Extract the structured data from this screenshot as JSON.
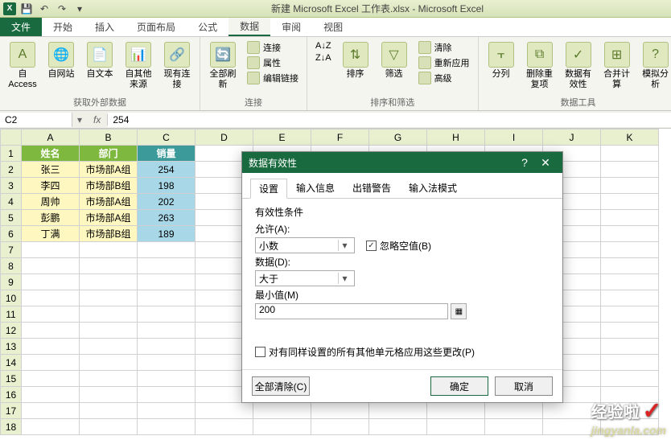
{
  "title": "新建 Microsoft Excel 工作表.xlsx - Microsoft Excel",
  "tabs": {
    "file": "文件",
    "items": [
      "开始",
      "插入",
      "页面布局",
      "公式",
      "数据",
      "审阅",
      "视图"
    ],
    "active_index": 4
  },
  "ribbon": {
    "g1": {
      "label": "获取外部数据",
      "btns": [
        "自 Access",
        "自网站",
        "自文本",
        "自其他来源",
        "现有连接"
      ]
    },
    "g2": {
      "label": "连接",
      "big": "全部刷新",
      "small": [
        "连接",
        "属性",
        "编辑链接"
      ]
    },
    "g3": {
      "label": "排序和筛选",
      "az": "A↓Z",
      "za": "Z↓A",
      "big": [
        "排序",
        "筛选"
      ],
      "small": [
        "清除",
        "重新应用",
        "高级"
      ]
    },
    "g4": {
      "label": "数据工具",
      "big": [
        "分列",
        "删除重复项",
        "数据有效性",
        "合并计算",
        "模拟分析"
      ]
    }
  },
  "formula_bar": {
    "name_box": "C2",
    "fx": "fx",
    "value": "254"
  },
  "columns": [
    "A",
    "B",
    "C",
    "D",
    "E",
    "F",
    "G",
    "H",
    "I",
    "J",
    "K"
  ],
  "rows_shown": 18,
  "headers": {
    "name": "姓名",
    "dept": "部门",
    "sales": "销量"
  },
  "data_rows": [
    {
      "name": "张三",
      "dept": "市场部A组",
      "sales": "254"
    },
    {
      "name": "李四",
      "dept": "市场部B组",
      "sales": "198"
    },
    {
      "name": "周帅",
      "dept": "市场部A组",
      "sales": "202"
    },
    {
      "name": "彭鹏",
      "dept": "市场部A组",
      "sales": "263"
    },
    {
      "name": "丁满",
      "dept": "市场部B组",
      "sales": "189"
    }
  ],
  "dialog": {
    "title": "数据有效性",
    "tabs": [
      "设置",
      "输入信息",
      "出错警告",
      "输入法模式"
    ],
    "active_tab": 0,
    "fieldset": "有效性条件",
    "allow_label": "允许(A):",
    "allow_value": "小数",
    "ignore_blank": "忽略空值(B)",
    "data_label": "数据(D):",
    "data_value": "大于",
    "min_label": "最小值(M)",
    "min_value": "200",
    "apply_all": "对有同样设置的所有其他单元格应用这些更改(P)",
    "clear_all": "全部清除(C)",
    "ok": "确定",
    "cancel": "取消"
  },
  "watermark": {
    "top": "经验啦",
    "url": "jingyanla.com"
  }
}
